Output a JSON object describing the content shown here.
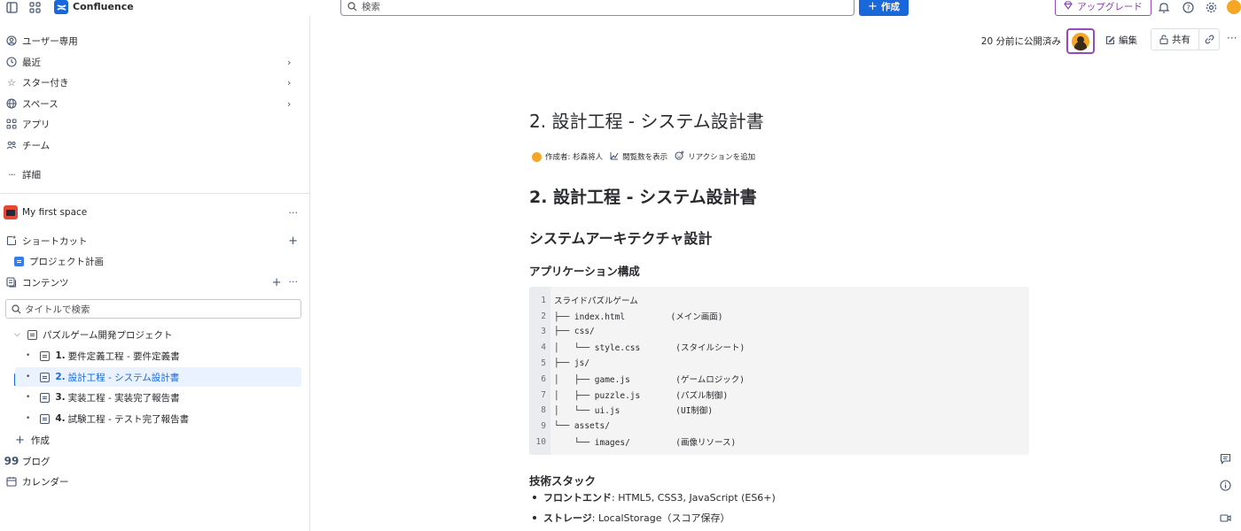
{
  "topbar": {
    "app_name": "Confluence",
    "search_placeholder": "検索",
    "create_label": "作成",
    "upgrade_label": "アップグレード"
  },
  "sidebar": {
    "nav": [
      {
        "label": "ユーザー専用",
        "icon": "user-circle-icon"
      },
      {
        "label": "最近",
        "icon": "clock-icon"
      },
      {
        "label": "スター付き",
        "icon": "star-icon"
      },
      {
        "label": "スペース",
        "icon": "globe-icon"
      },
      {
        "label": "アプリ",
        "icon": "apps-icon"
      },
      {
        "label": "チーム",
        "icon": "team-icon"
      },
      {
        "label": "詳細",
        "icon": "more-icon"
      }
    ],
    "space_name": "My first space",
    "shortcuts_label": "ショートカット",
    "shortcut_item": "プロジェクト計画",
    "content_label": "コンテンツ",
    "title_search_placeholder": "タイトルで検索",
    "tree": {
      "parent": "パズルゲーム開発プロジェクト",
      "children": [
        {
          "num": "1.",
          "label": "要件定義工程 - 要件定義書"
        },
        {
          "num": "2.",
          "label": "設計工程 - システム設計書"
        },
        {
          "num": "3.",
          "label": "実装工程 - 実装完了報告書"
        },
        {
          "num": "4.",
          "label": "試験工程 - テスト完了報告書"
        }
      ]
    },
    "create_label": "作成",
    "blog_label": "ブログ",
    "calendar_label": "カレンダー"
  },
  "header": {
    "published": "20 分前に公開済み",
    "edit_label": "編集",
    "share_label": "共有"
  },
  "page": {
    "title": "2. 設計工程 - システム設計書",
    "byline_author": "作成者: 杉森将人",
    "byline_views": "閲覧数を表示",
    "byline_reaction": "リアクションを追加",
    "h1": "2. 設計工程 - システム設計書",
    "h2": "システムアーキテクチャ設計",
    "h3_app": "アプリケーション構成",
    "code_lines": [
      {
        "n": "1",
        "text": "スライドパズルゲーム"
      },
      {
        "n": "2",
        "text": "├── index.html         (メイン画面)"
      },
      {
        "n": "3",
        "text": "├── css/"
      },
      {
        "n": "4",
        "text": "│   └── style.css       (スタイルシート)"
      },
      {
        "n": "5",
        "text": "├── js/"
      },
      {
        "n": "6",
        "text": "│   ├── game.js         (ゲームロジック)"
      },
      {
        "n": "7",
        "text": "│   ├── puzzle.js       (パズル制御)"
      },
      {
        "n": "8",
        "text": "│   └── ui.js           (UI制御)"
      },
      {
        "n": "9",
        "text": "└── assets/"
      },
      {
        "n": "10",
        "text": "    └── images/         (画像リソース)"
      }
    ],
    "h3_tech": "技術スタック",
    "bullets": [
      {
        "key": "フロントエンド",
        "value": ": HTML5, CSS3, JavaScript (ES6+)"
      },
      {
        "key": "ストレージ",
        "value": ": LocalStorage（スコア保存）"
      }
    ]
  },
  "colors": {
    "brand_blue": "#1868db",
    "upgrade_purple": "#803fa5",
    "selected_bg": "#e9f2fe",
    "avatar_orange": "#f5a623"
  }
}
